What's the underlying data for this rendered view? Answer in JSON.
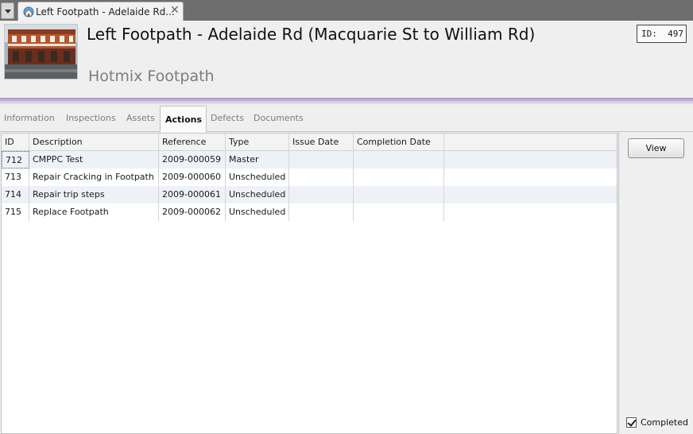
{
  "tabstrip": {
    "dropdown_icon": "chevron-down-icon",
    "tab_title": "Left Footpath - Adelaide Rd...",
    "tab_icon": "globe-house-icon",
    "close_glyph": "✕"
  },
  "header": {
    "title": "Left Footpath - Adelaide Rd (Macquarie St to William Rd)",
    "subtitle": "Hotmix Footpath",
    "id_label": "ID:",
    "id_value": "497",
    "accent_color": "#a78ec4"
  },
  "section_tabs": [
    {
      "label": "Information",
      "active": false
    },
    {
      "label": "Inspections",
      "active": false
    },
    {
      "label": "Assets",
      "active": false
    },
    {
      "label": "Actions",
      "active": true
    },
    {
      "label": "Defects",
      "active": false
    },
    {
      "label": "Documents",
      "active": false
    }
  ],
  "grid": {
    "columns": [
      "ID",
      "Description",
      "Reference",
      "Type",
      "Issue Date",
      "Completion Date"
    ],
    "rows": [
      {
        "id": "712",
        "description": "CMPPC Test",
        "reference": "2009-000059",
        "type": "Master",
        "issue_date": "",
        "completion_date": ""
      },
      {
        "id": "713",
        "description": "Repair Cracking in Footpath",
        "reference": "2009-000060",
        "type": "Unscheduled",
        "issue_date": "",
        "completion_date": ""
      },
      {
        "id": "714",
        "description": "Repair trip steps",
        "reference": "2009-000061",
        "type": "Unscheduled",
        "issue_date": "",
        "completion_date": ""
      },
      {
        "id": "715",
        "description": "Replace Footpath",
        "reference": "2009-000062",
        "type": "Unscheduled",
        "issue_date": "",
        "completion_date": ""
      }
    ]
  },
  "side": {
    "view_label": "View",
    "completed_label": "Completed",
    "completed_checked": true
  }
}
